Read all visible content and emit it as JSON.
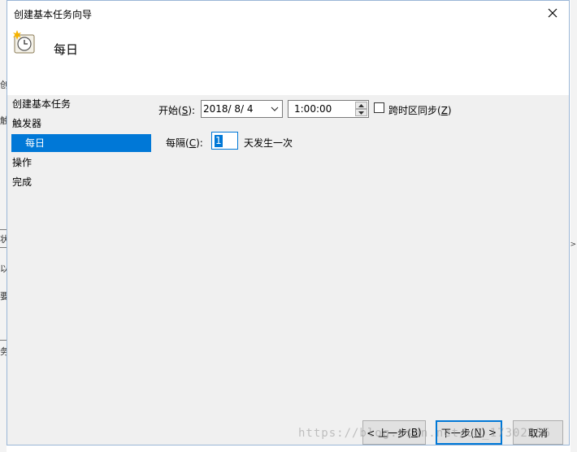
{
  "window": {
    "title": "创建基本任务向导",
    "close_glyph": "✕"
  },
  "header": {
    "title": "每日",
    "icon": "clock-icon"
  },
  "sidebar": {
    "items": [
      {
        "label": "创建基本任务"
      },
      {
        "label": "触发器"
      },
      {
        "label": "每日"
      },
      {
        "label": "操作"
      },
      {
        "label": "完成"
      }
    ]
  },
  "trigger": {
    "start_label_pre": "开始(",
    "start_label_key": "S",
    "start_label_post": "):",
    "start_date": "2018/ 8/ 4",
    "start_time": "1:00:00",
    "sync_label_pre": "跨时区同步(",
    "sync_label_key": "Z",
    "sync_label_post": ")",
    "sync_checked": false,
    "interval_label_pre": "每隔(",
    "interval_label_key": "C",
    "interval_label_post": "):",
    "interval_value": "1",
    "interval_suffix": "天发生一次"
  },
  "buttons": {
    "back_pre": "< 上一步(",
    "back_key": "B",
    "back_post": ")",
    "next_pre": "下一步(",
    "next_key": "N",
    "next_post": ") >",
    "cancel": "取消"
  },
  "background_fragments": [
    "创",
    "触",
    "状",
    "以",
    "要",
    "务"
  ],
  "watermark": "https://blog.csdn.net/u0_17302255",
  "colors": {
    "accent": "#0078d7",
    "dialog_bg": "#f0f0f0"
  }
}
